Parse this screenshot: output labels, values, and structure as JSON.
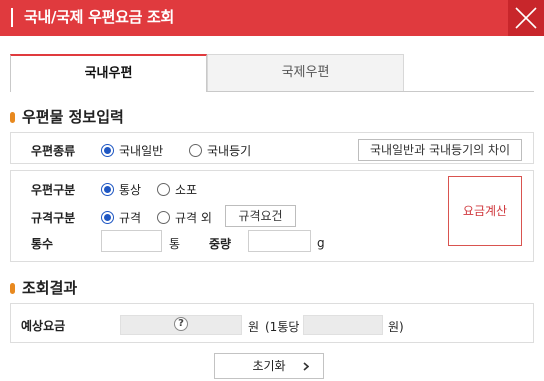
{
  "header": {
    "title": "국내/국제 우편요금 조회"
  },
  "tabs": [
    {
      "label": "국내우편"
    },
    {
      "label": "국제우편"
    }
  ],
  "info_section": {
    "title": "우편물 정보입력"
  },
  "mail_type": {
    "label": "우편종류",
    "options": [
      "국내일반",
      "국내등기"
    ],
    "selected": "국내일반",
    "diff_button": "국내일반과 국내등기의 차이"
  },
  "mail_class": {
    "label": "우편구분",
    "options": [
      "통상",
      "소포"
    ],
    "selected": "통상"
  },
  "size_class": {
    "label": "규격구분",
    "options": [
      "규격",
      "규격 외"
    ],
    "selected": "규격",
    "req_button": "규격요건"
  },
  "count": {
    "label": "통수",
    "value": "",
    "unit": "통"
  },
  "weight": {
    "label": "중량",
    "value": "",
    "unit": "g"
  },
  "calc_button": "요금계산",
  "result_section": {
    "title": "조회결과"
  },
  "result": {
    "label": "예상요금",
    "help_icon": "?",
    "unit": "원",
    "per_item_prefix": "(1통당",
    "per_item_suffix": "원)"
  },
  "reset_button": "초기화",
  "colors": {
    "accent": "#e03a3e",
    "radio": "#1f57c3",
    "section_dot": "#e8891f"
  }
}
